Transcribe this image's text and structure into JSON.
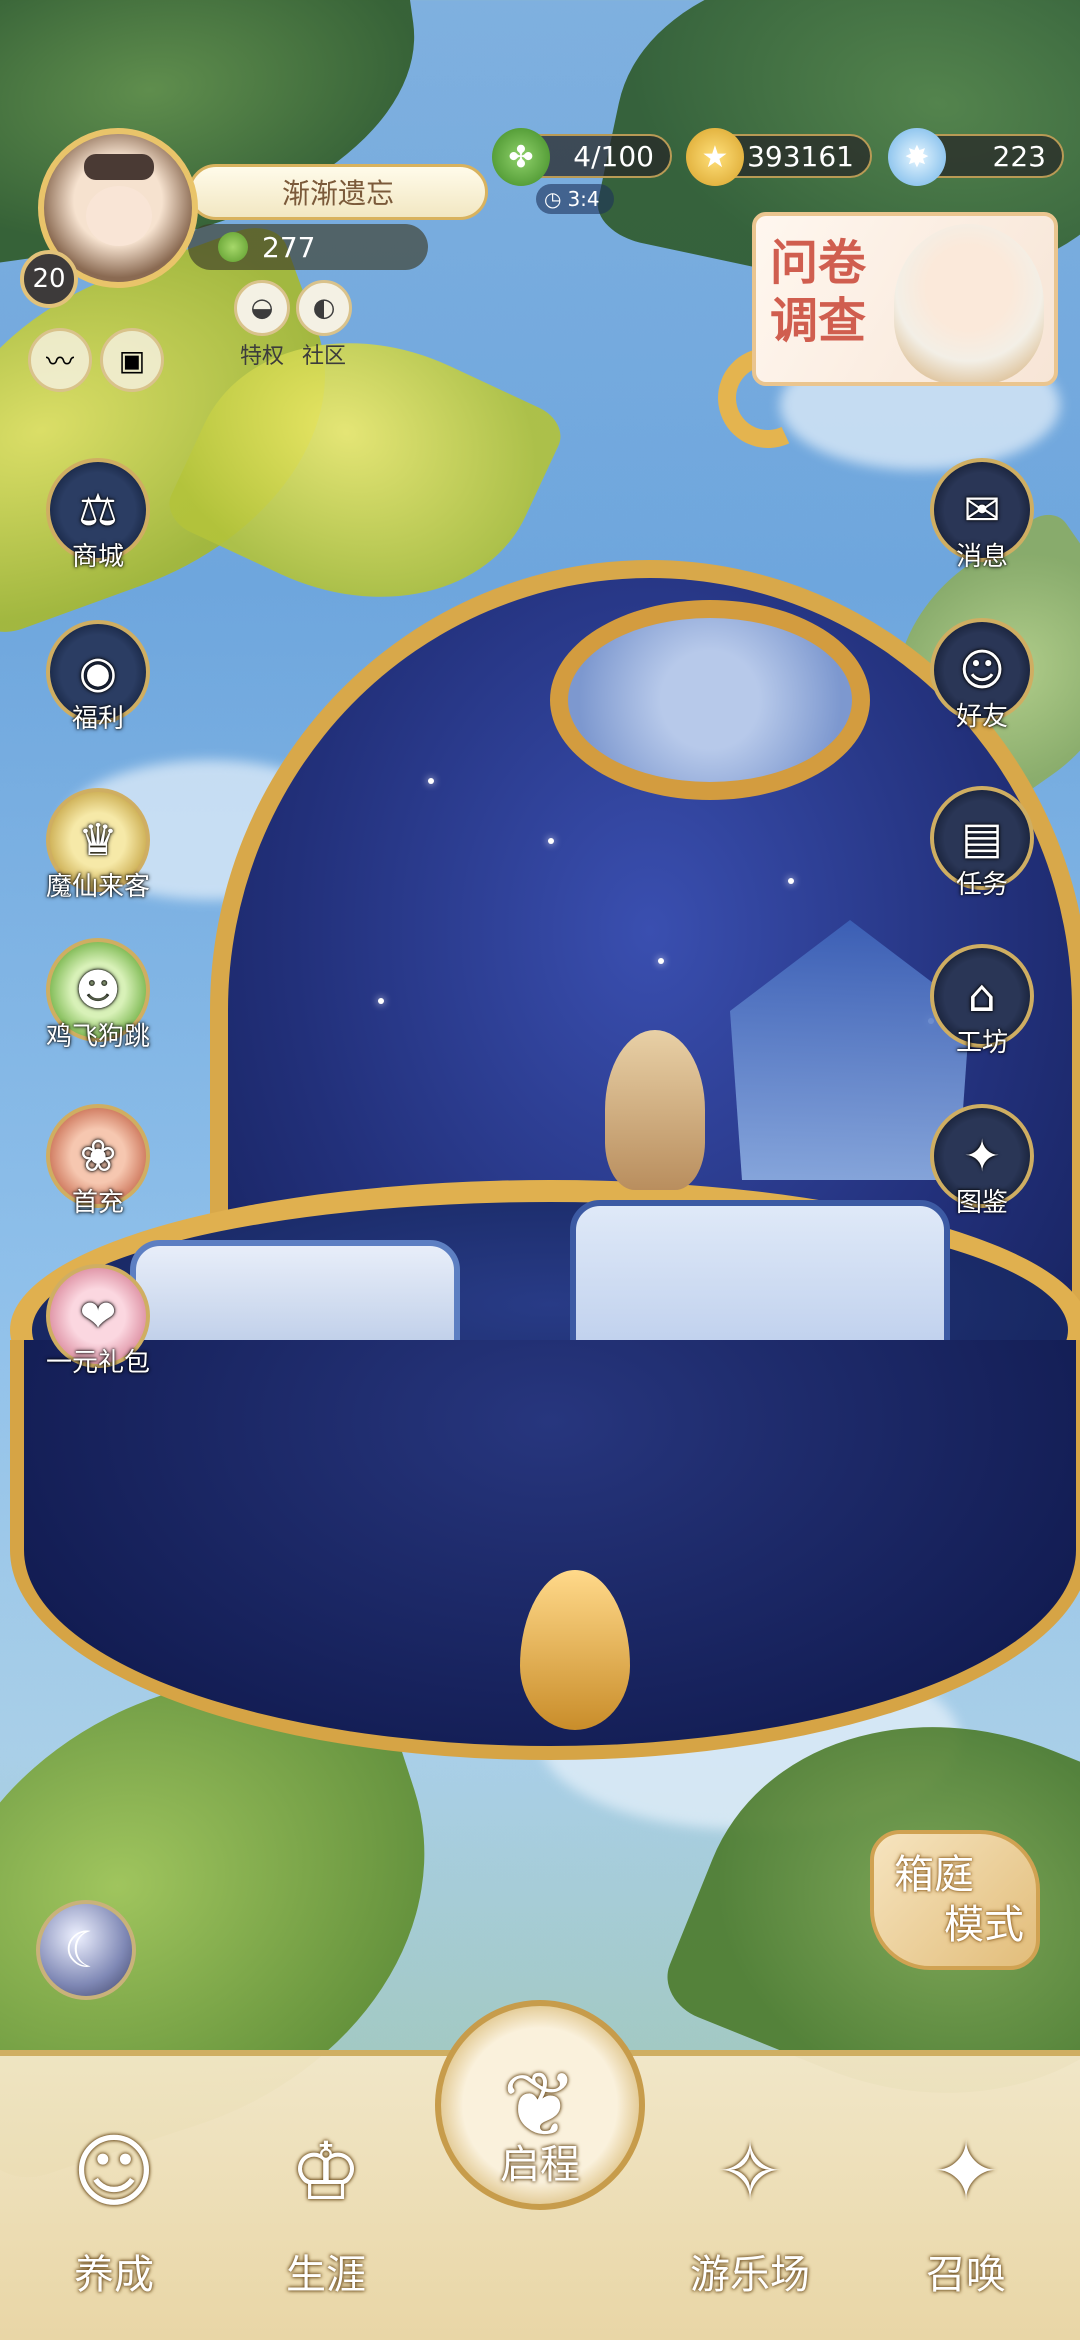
{
  "profile": {
    "name": "渐渐遗忘",
    "level": "20",
    "clovers": "277"
  },
  "perks": [
    {
      "label": "特权",
      "icon": "penguin-icon"
    },
    {
      "label": "社区",
      "icon": "mask-icon"
    }
  ],
  "resources": {
    "stamina": "4/100",
    "stamina_timer": "3:4",
    "gold": "393161",
    "diamonds": "223"
  },
  "survey": {
    "line1": "问卷",
    "line2": "调查"
  },
  "left_menu": [
    {
      "label": "商城",
      "icon": "scales-icon"
    },
    {
      "label": "福利",
      "icon": "globe-gift-icon"
    },
    {
      "label": "魔仙来客",
      "icon": "crown-badge-icon"
    },
    {
      "label": "鸡飞狗跳",
      "icon": "green-pet-icon"
    },
    {
      "label": "首充",
      "icon": "purse-icon"
    },
    {
      "label": "一元礼包",
      "icon": "gift-box-icon"
    }
  ],
  "right_menu": [
    {
      "label": "消息",
      "icon": "envelope-icon"
    },
    {
      "label": "好友",
      "icon": "friends-icon"
    },
    {
      "label": "任务",
      "icon": "clipboard-icon"
    },
    {
      "label": "工坊",
      "icon": "workshop-icon"
    },
    {
      "label": "图鉴",
      "icon": "album-icon"
    }
  ],
  "mode_badge": {
    "line1": "箱庭",
    "line2": "模式"
  },
  "bottom_nav": [
    {
      "label": "养成",
      "icon": "girl-portrait-icon"
    },
    {
      "label": "生涯",
      "icon": "crown-icon"
    },
    {
      "label": "启程",
      "icon": "open-book-icon"
    },
    {
      "label": "游乐场",
      "icon": "star-emblem-icon"
    },
    {
      "label": "召唤",
      "icon": "card-star-icon"
    }
  ],
  "colors": {
    "gold_trim": "#d8a84a",
    "globe_blue": "#22307a",
    "survey_red": "#d05e4f"
  }
}
